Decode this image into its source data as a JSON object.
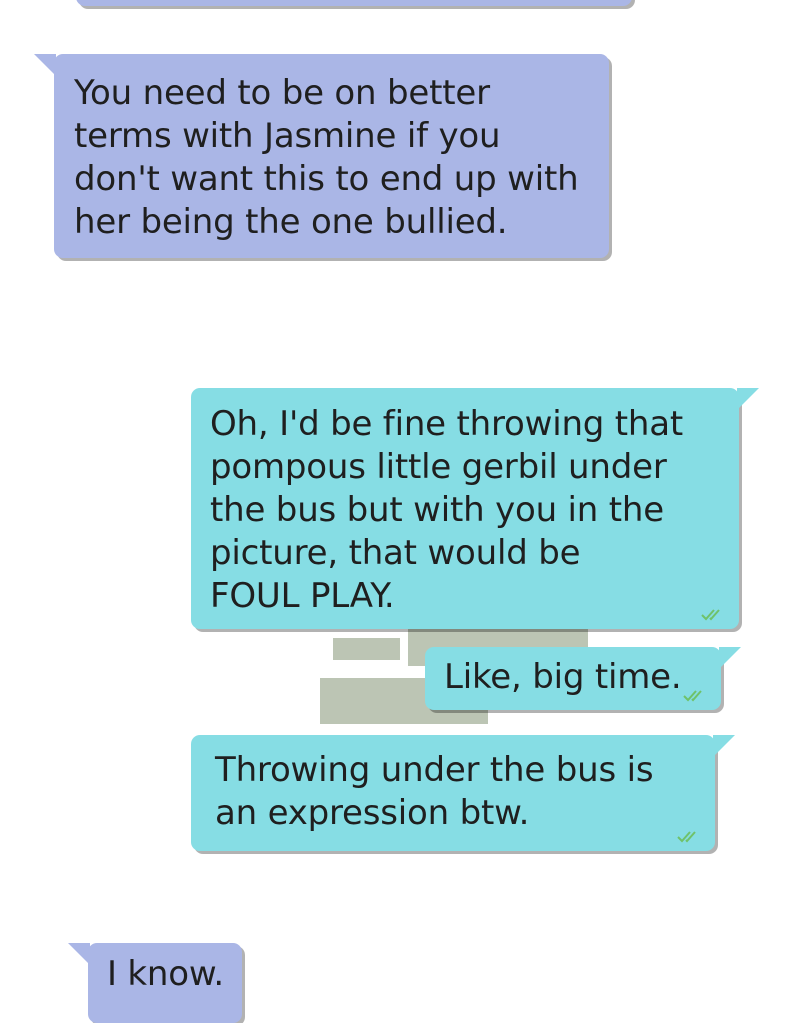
{
  "colors": {
    "incoming_bubble": "#aab6e6",
    "outgoing_bubble": "#86dde4",
    "read_ticks": "#6fc26a",
    "background_blocks": "#bcc5b4"
  },
  "messages": [
    {
      "direction": "incoming",
      "text": "You need to be on better\nterms with Jasmine if you\ndon't want this to end up with\nher being the one bullied."
    },
    {
      "direction": "outgoing",
      "text": "Oh, I'd be fine throwing that\npompous little gerbil under\nthe bus but with you in the\npicture, that would be\nFOUL PLAY.",
      "status_icon": "double-check-icon"
    },
    {
      "direction": "outgoing",
      "text": "Like, big time.",
      "status_icon": "double-check-icon"
    },
    {
      "direction": "outgoing",
      "text": "Throwing under the bus is\nan expression btw.",
      "status_icon": "double-check-icon"
    },
    {
      "direction": "incoming",
      "text": "I know."
    }
  ]
}
